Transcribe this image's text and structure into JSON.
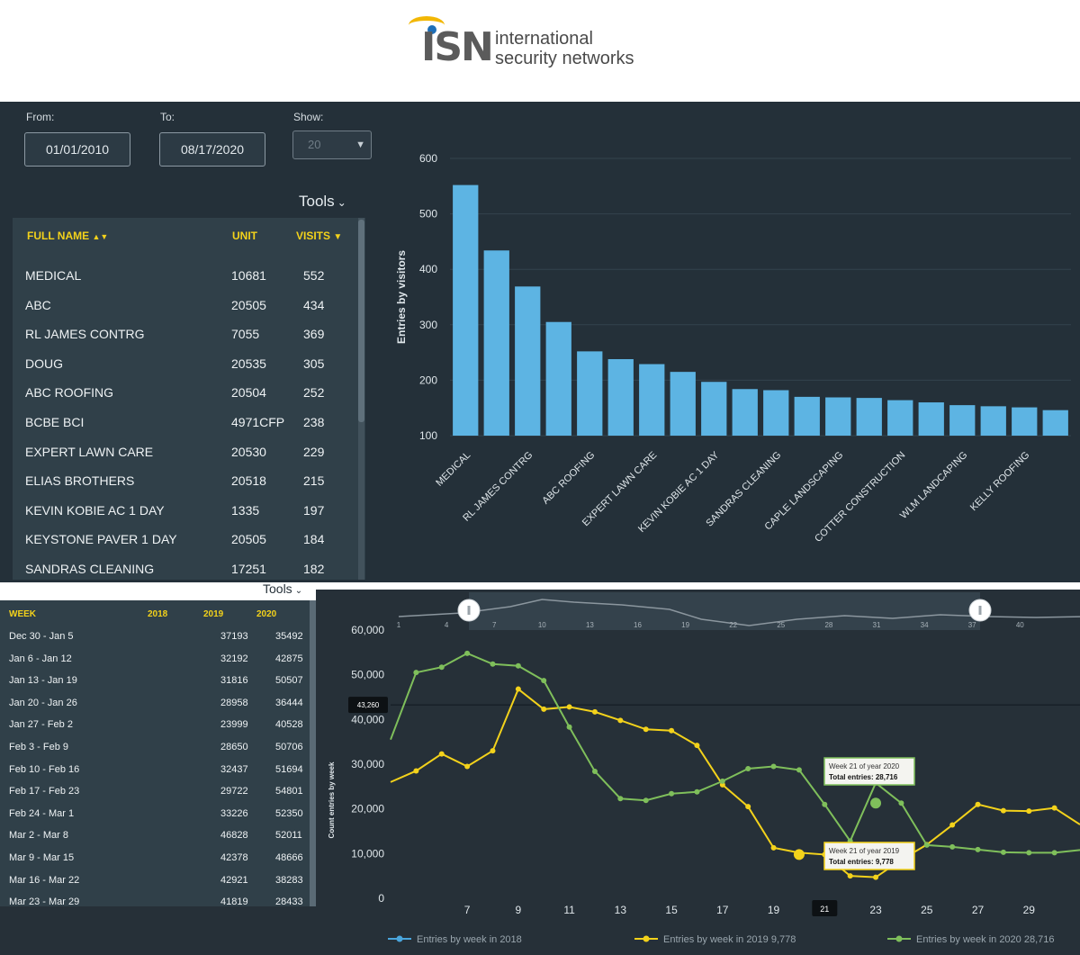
{
  "logo": {
    "mark": "ISN",
    "line1": "international",
    "line2": "security networks"
  },
  "filters": {
    "from_label": "From:",
    "from_value": "01/01/2010",
    "to_label": "To:",
    "to_value": "08/17/2020",
    "show_label": "Show:",
    "show_value": "20"
  },
  "tools_label": "Tools",
  "visitors_table": {
    "columns": [
      "FULL NAME",
      "UNIT",
      "VISITS"
    ],
    "rows": [
      {
        "name": "MEDICAL",
        "unit": "10681",
        "visits": "552"
      },
      {
        "name": "ABC",
        "unit": "20505",
        "visits": "434"
      },
      {
        "name": "RL JAMES CONTRG",
        "unit": "7055",
        "visits": "369"
      },
      {
        "name": "DOUG",
        "unit": "20535",
        "visits": "305"
      },
      {
        "name": "ABC ROOFING",
        "unit": "20504",
        "visits": "252"
      },
      {
        "name": "BCBE BCI",
        "unit": "4971CFP",
        "visits": "238"
      },
      {
        "name": "EXPERT LAWN CARE",
        "unit": "20530",
        "visits": "229"
      },
      {
        "name": "ELIAS BROTHERS",
        "unit": "20518",
        "visits": "215"
      },
      {
        "name": "KEVIN KOBIE AC 1 DAY",
        "unit": "1335",
        "visits": "197"
      },
      {
        "name": "KEYSTONE PAVER 1 DAY",
        "unit": "20505",
        "visits": "184"
      },
      {
        "name": "SANDRAS CLEANING",
        "unit": "17251",
        "visits": "182"
      }
    ]
  },
  "weeks_table": {
    "columns": [
      "WEEK",
      "2018",
      "2019",
      "2020"
    ],
    "rows": [
      {
        "week": "Dec 30 - Jan 5",
        "y2018": "",
        "y2019": "37193",
        "y2020": "35492"
      },
      {
        "week": "Jan 6 - Jan 12",
        "y2018": "",
        "y2019": "32192",
        "y2020": "42875"
      },
      {
        "week": "Jan 13 - Jan 19",
        "y2018": "",
        "y2019": "31816",
        "y2020": "50507"
      },
      {
        "week": "Jan 20 - Jan 26",
        "y2018": "",
        "y2019": "28958",
        "y2020": "36444"
      },
      {
        "week": "Jan 27 - Feb 2",
        "y2018": "",
        "y2019": "23999",
        "y2020": "40528"
      },
      {
        "week": "Feb 3 - Feb 9",
        "y2018": "",
        "y2019": "28650",
        "y2020": "50706"
      },
      {
        "week": "Feb 10 - Feb 16",
        "y2018": "",
        "y2019": "32437",
        "y2020": "51694"
      },
      {
        "week": "Feb 17 - Feb 23",
        "y2018": "",
        "y2019": "29722",
        "y2020": "54801"
      },
      {
        "week": "Feb 24 - Mar 1",
        "y2018": "",
        "y2019": "33226",
        "y2020": "52350"
      },
      {
        "week": "Mar 2 - Mar 8",
        "y2018": "",
        "y2019": "46828",
        "y2020": "52011"
      },
      {
        "week": "Mar 9 - Mar 15",
        "y2018": "",
        "y2019": "42378",
        "y2020": "48666"
      },
      {
        "week": "Mar 16 - Mar 22",
        "y2018": "",
        "y2019": "42921",
        "y2020": "38283"
      },
      {
        "week": "Mar 23 - Mar 29",
        "y2018": "",
        "y2019": "41819",
        "y2020": "28433"
      }
    ]
  },
  "chart_data": [
    {
      "type": "bar",
      "ylabel": "Entries by visitors",
      "ylim": [
        100,
        600
      ],
      "yticks": [
        100,
        200,
        300,
        400,
        500,
        600
      ],
      "color": "#5db4e3",
      "values": [
        552,
        434,
        369,
        305,
        252,
        238,
        229,
        215,
        197,
        184,
        182,
        170,
        169,
        168,
        164,
        160,
        155,
        153,
        151,
        146
      ],
      "tick_labels": [
        {
          "index": 0,
          "label": "MEDICAL"
        },
        {
          "index": 2,
          "label": "RL JAMES CONTRG"
        },
        {
          "index": 4,
          "label": "ABC ROOFING"
        },
        {
          "index": 6,
          "label": "EXPERT LAWN CARE"
        },
        {
          "index": 8,
          "label": "KEVIN KOBIE AC 1 DAY"
        },
        {
          "index": 10,
          "label": "SANDRAS CLEANING"
        },
        {
          "index": 12,
          "label": "CAPLE LANDSCAPING"
        },
        {
          "index": 14,
          "label": "COTTER CONSTRUCTION"
        },
        {
          "index": 16,
          "label": "WLM LANDCAPING"
        },
        {
          "index": 18,
          "label": "KELLY ROOFING"
        }
      ]
    },
    {
      "type": "line",
      "ylabel": "Count entries by week",
      "ylim": [
        0,
        60000
      ],
      "yticks": [
        "0",
        "10,000",
        "20,000",
        "30,000",
        "40,000",
        "50,000",
        "60,000"
      ],
      "xlim": [
        4,
        31
      ],
      "xticks": [
        7,
        9,
        11,
        13,
        15,
        17,
        19,
        21,
        23,
        25,
        27,
        29
      ],
      "navigator_ticks": [
        1,
        4,
        7,
        10,
        13,
        16,
        19,
        22,
        25,
        28,
        31,
        34,
        37,
        40
      ],
      "crosshair_y_label": "43,260",
      "crosshair_x_label": "21",
      "series": [
        {
          "name": "Entries by week in 2018",
          "color": "#4aa6dd",
          "x": [],
          "y": []
        },
        {
          "name": "Entries by week in 2019 9,778",
          "color": "#f3d21b",
          "x": [
            4,
            5,
            6,
            7,
            8,
            9,
            10,
            11,
            12,
            13,
            14,
            15,
            16,
            17,
            18,
            19,
            20,
            21,
            22,
            23,
            24,
            25,
            26,
            27,
            28,
            29,
            30,
            31
          ],
          "y": [
            26000,
            28500,
            32300,
            29500,
            33000,
            46800,
            42300,
            42800,
            41700,
            39800,
            37800,
            37500,
            34200,
            25400,
            20500,
            11300,
            10200,
            9778,
            5000,
            4700,
            8600,
            12000,
            16400,
            21000,
            19600,
            19500,
            20200,
            16500
          ]
        },
        {
          "name": "Entries by week in 2020 28,716",
          "color": "#7fbf5b",
          "x": [
            4,
            5,
            6,
            7,
            8,
            9,
            10,
            11,
            12,
            13,
            14,
            15,
            16,
            17,
            18,
            19,
            20,
            21,
            22,
            23,
            24,
            25,
            26,
            27,
            28,
            29,
            30,
            31
          ],
          "y": [
            35500,
            50500,
            51700,
            54800,
            52400,
            52000,
            48700,
            38300,
            28400,
            22300,
            21900,
            23400,
            23800,
            26200,
            29000,
            29500,
            28716,
            21000,
            12800,
            25800,
            21300,
            11900,
            11500,
            10900,
            10300,
            10200,
            10200,
            10800
          ]
        }
      ],
      "tooltips": [
        {
          "title": "Week 21 of year 2020",
          "body": "Total entries: 28,716"
        },
        {
          "title": "Week 21 of year 2019",
          "body": "Total entries: 9,778"
        }
      ]
    }
  ]
}
